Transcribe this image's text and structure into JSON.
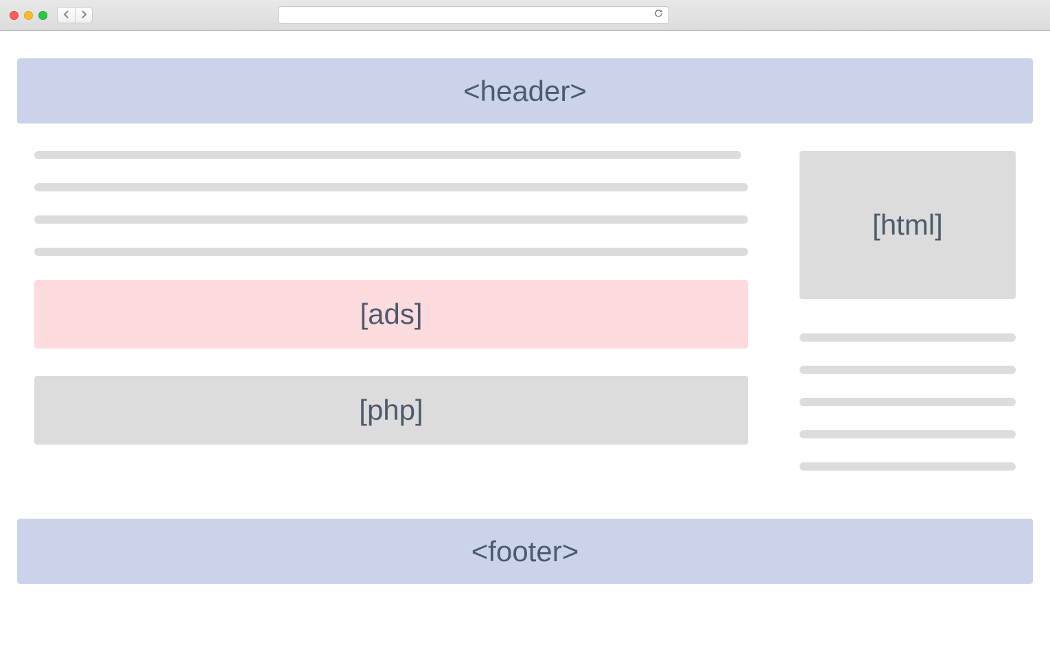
{
  "browser": {
    "address_value": ""
  },
  "layout": {
    "header_label": "<header>",
    "footer_label": "<footer>",
    "main": {
      "ads_label": "[ads]",
      "php_label": "[php]"
    },
    "sidebar": {
      "html_label": "[html]"
    }
  }
}
